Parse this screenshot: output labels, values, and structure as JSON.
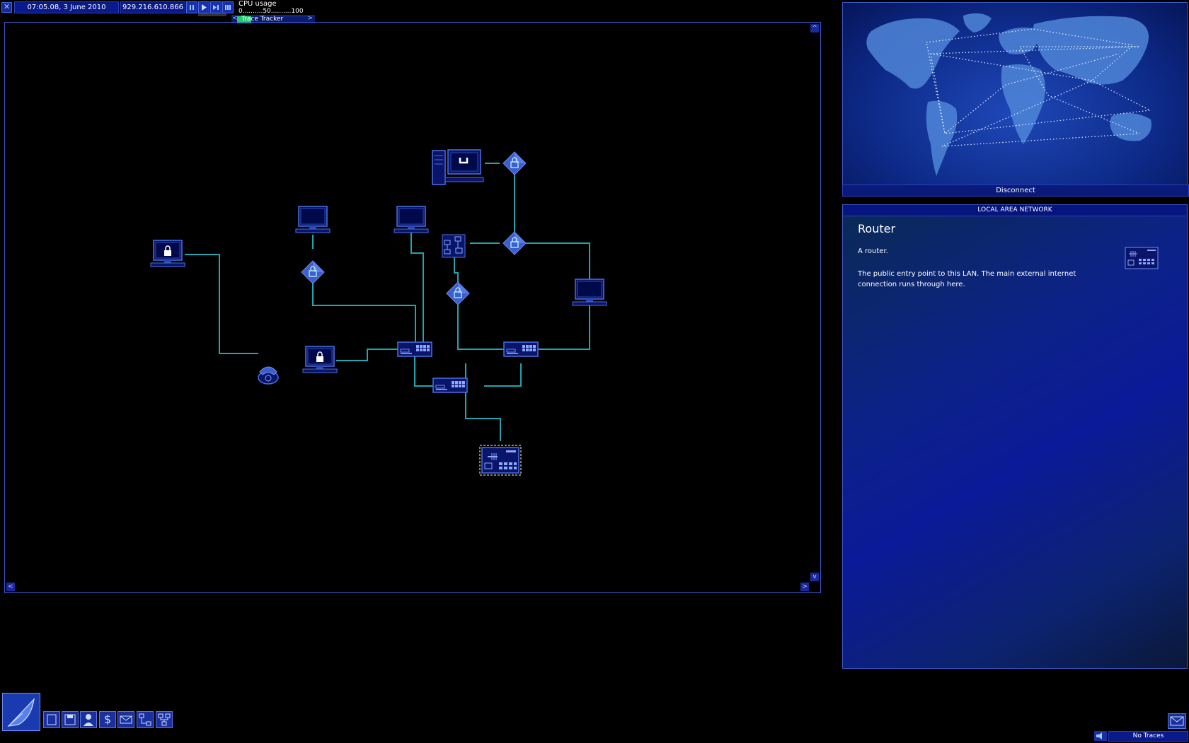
{
  "topbar": {
    "close_icon": "close-icon",
    "datetime": "07:05.08, 3 June 2010",
    "ip_address": "929.216.610.866",
    "speed_buttons": [
      "pause-icon",
      "play-icon",
      "fast-forward-icon",
      "fastest-icon"
    ],
    "cpu_label": "CPU usage",
    "cpu_scale": "0..........50..........100",
    "tracker_label": "Trace Tracker",
    "tracker_left": "<",
    "tracker_right": ">"
  },
  "lan_view": {
    "scroll_up": "^",
    "scroll_down": "v",
    "scroll_left": "<",
    "scroll_right": ">",
    "colors": {
      "link": "#1fa6b0",
      "node": "#4a70e0",
      "node_fill": "#0a1468"
    }
  },
  "world_map": {
    "disconnect_label": "Disconnect"
  },
  "info": {
    "header": "LOCAL AREA NETWORK",
    "title": "Router",
    "description": "A router.",
    "details": "The public entry point to this LAN. The main external internet connection runs through here."
  },
  "taskbar": {
    "start_icon": "satellite-dish-icon",
    "buttons": [
      "computer-icon",
      "floppy-disk-icon",
      "person-icon",
      "dollar-icon",
      "mail-icon",
      "network-icon",
      "lan-icon"
    ]
  },
  "status": {
    "traces": "No Traces",
    "mail_icon": "mail-icon"
  }
}
